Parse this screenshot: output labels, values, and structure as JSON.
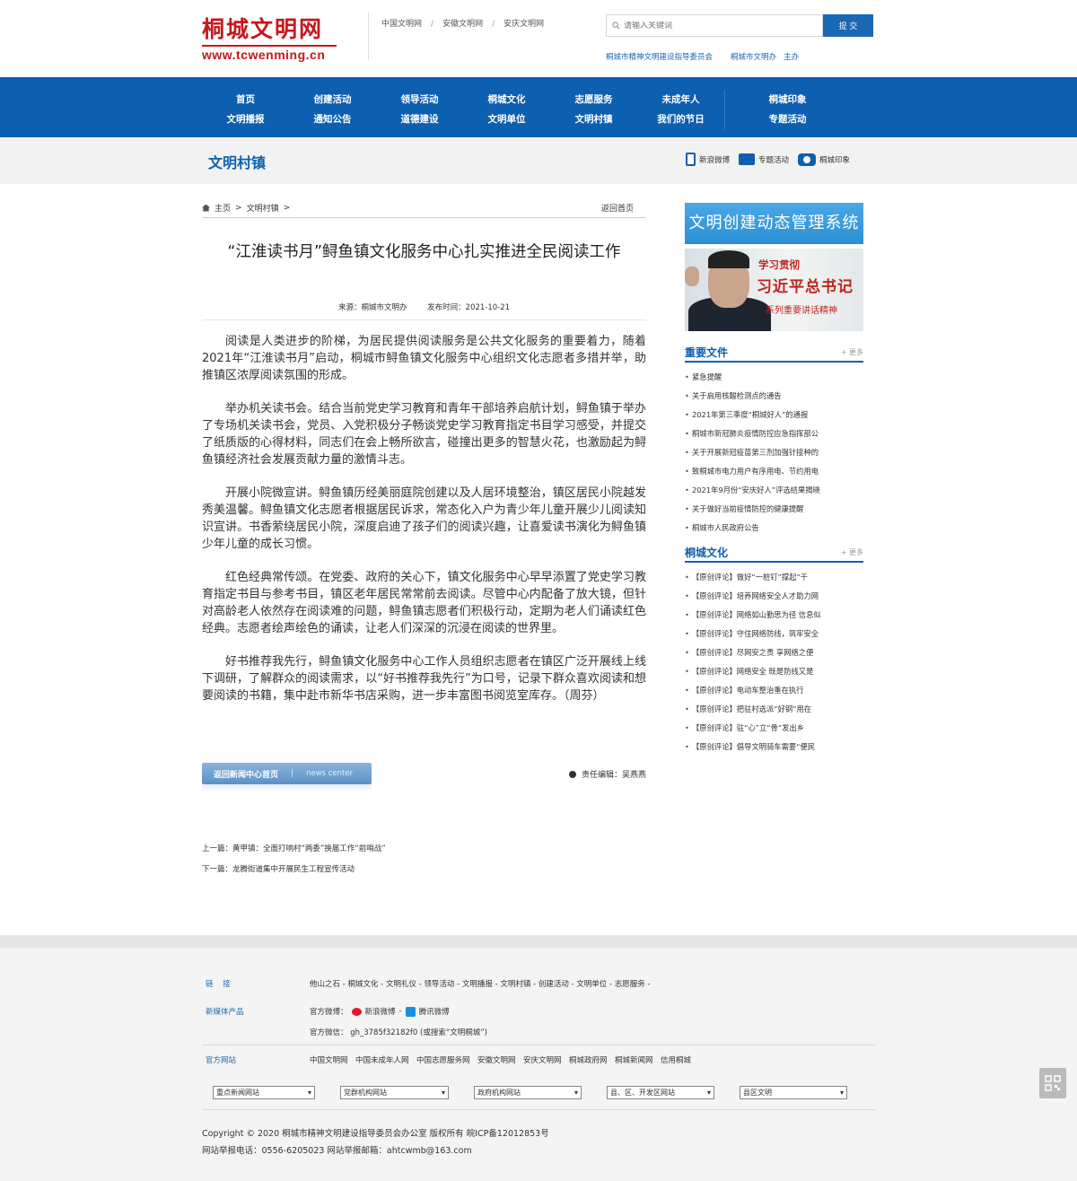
{
  "header": {
    "logo_cn": "桐城文明网",
    "logo_en": "www.tcwenming.cn",
    "top_links": [
      "中国文明网",
      "安徽文明网",
      "安庆文明网"
    ],
    "search_placeholder": "请输入关键词",
    "search_button": "提 交",
    "sponsor_org": "桐城市精神文明建设指导委员会",
    "sponsor_office": "桐城市文明办",
    "sponsor_role": "主办"
  },
  "nav": [
    [
      "首页",
      "文明播报"
    ],
    [
      "创建活动",
      "通知公告"
    ],
    [
      "领导活动",
      "道德建设"
    ],
    [
      "桐城文化",
      "文明单位"
    ],
    [
      "志愿服务",
      "文明村镇"
    ],
    [
      "未成年人",
      "我们的节日"
    ],
    [
      "桐城印象",
      "专题活动"
    ]
  ],
  "subhead": {
    "title": "文明村镇",
    "quick_links": [
      "新浪微博",
      "专题活动",
      "桐城印象"
    ]
  },
  "breadcrumb": {
    "home": "主页",
    "section": "文明村镇",
    "back": "返回首页"
  },
  "article": {
    "title": "“江淮读书月”鲟鱼镇文化服务中心扎实推进全民阅读工作",
    "source": "来源：桐城市文明办",
    "date": "发布时间：2021-10-21",
    "paragraphs": [
      "阅读是人类进步的阶梯，为居民提供阅读服务是公共文化服务的重要着力，随着2021年“江淮读书月”启动，桐城市鲟鱼镇文化服务中心组织文化志愿者多措并举，助推镇区浓厚阅读氛围的形成。",
      "举办机关读书会。结合当前党史学习教育和青年干部培养启航计划，鲟鱼镇于举办了专场机关读书会，党员、入党积极分子畅谈党史学习教育指定书目学习感受，并提交了纸质版的心得材料，同志们在会上畅所欲言，碰撞出更多的智慧火花，也激励起为鲟鱼镇经济社会发展贡献力量的激情斗志。",
      "开展小院微宣讲。鲟鱼镇历经美丽庭院创建以及人居环境整治，镇区居民小院越发秀美温馨。鲟鱼镇文化志愿者根据居民诉求，常态化入户为青少年儿童开展少儿阅读知识宣讲。书香萦绕居民小院，深度启迪了孩子们的阅读兴趣，让喜爱读书演化为鲟鱼镇少年儿童的成长习惯。",
      "红色经典常传颂。在党委、政府的关心下，镇文化服务中心早早添置了党史学习教育指定书目与参考书目，镇区老年居民常常前去阅读。尽管中心内配备了放大镜，但针对高龄老人依然存在阅读难的问题，鲟鱼镇志愿者们积极行动，定期为老人们诵读红色经典。志愿者绘声绘色的诵读，让老人们深深的沉浸在阅读的世界里。",
      "好书推荐我先行，鲟鱼镇文化服务中心工作人员组织志愿者在镇区广泛开展线上线下调研，了解群众的阅读需求，以“好书推荐我先行”为口号，记录下群众喜欢阅读和想要阅读的书籍，集中赴市新华书店采购，进一步丰富图书阅览室库存。（周芬）"
    ],
    "back_button": "返回新闻中心首页",
    "back_button_en": "news center",
    "editor": "责任编辑：吴燕燕",
    "prev": "上一篇：黄甲镇：全面打响村“两委”换届工作“前哨战”",
    "next": "下一篇：龙腾街道集中开展民生工程宣传活动"
  },
  "sidebar": {
    "system_banner": "文明创建动态管理系统",
    "study_line1": "学习贯彻",
    "study_line2": "习近平总书记",
    "study_line3": "系列重要讲话精神",
    "block1_title": "重要文件",
    "block1_more": "+ 更多",
    "block1_items": [
      "紧急提醒",
      "关于启用核酸检测点的通告",
      "2021年第三季度“桐城好人”的通报",
      "桐城市新冠肺炎疫情防控应急指挥部公",
      "关于开展新冠疫苗第三剂加强针接种的",
      "致桐城市电力用户有序用电、节约用电",
      "2021年9月份“安庆好人”评选结果揭晓",
      "关于做好当前疫情防控的健康提醒",
      "桐城市人民政府公告"
    ],
    "block2_title": "桐城文化",
    "block2_more": "+ 更多",
    "block2_items": [
      "【原创评论】做好“一桩钉”撑起“千",
      "【原创评论】培养网络安全人才助力网",
      "【原创评论】网络如山勤思为径 信息似",
      "【原创评论】守住网络防线，筑牢安全",
      "【原创评论】尽网安之责 享网络之便",
      "【原创评论】网络安全 既是防线又是",
      "【原创评论】电动车整治重在执行",
      "【原创评论】把驻村选派“好钢”用在",
      "【原创评论】驻“心”立“骨”发出乡",
      "【原创评论】倡导文明骑车需要“便民"
    ]
  },
  "footer": {
    "links_label": "链    接",
    "links": "他山之石 - 桐城文化 - 文明礼仪 - 领导活动 - 文明播报 - 文明村镇 - 创建活动 - 文明单位 - 志愿服务 -",
    "media_label": "新媒体产品",
    "weibo_label": "官方微博：",
    "weibo_sina": "新浪微博",
    "weibo_tencent": "腾讯微博",
    "wechat": "官方微信： gh_3785f32182f0 (或搜索“文明桐城”)",
    "official_label": "官方网站",
    "official_sites": "中国文明网　中国未成年人网　中国志愿服务网　安徽文明网　安庆文明网　桐城政府网　桐城新闻网　信用桐城",
    "selects": [
      "重点新闻网站",
      "党群机构网站",
      "政府机构网站",
      "县、区、开发区网站",
      "县区文明"
    ],
    "copyright": "Copyright © 2020 桐城市精神文明建设指导委员会办公室 版权所有 皖ICP备12012853号",
    "report": "网站举报电话：0556-6205023 网站举报邮箱：ahtcwmb@163.com"
  },
  "colors": {
    "brand_red": "#c8161d",
    "nav_blue": "#0d5fb0",
    "accent_blue": "#1a67b3"
  }
}
